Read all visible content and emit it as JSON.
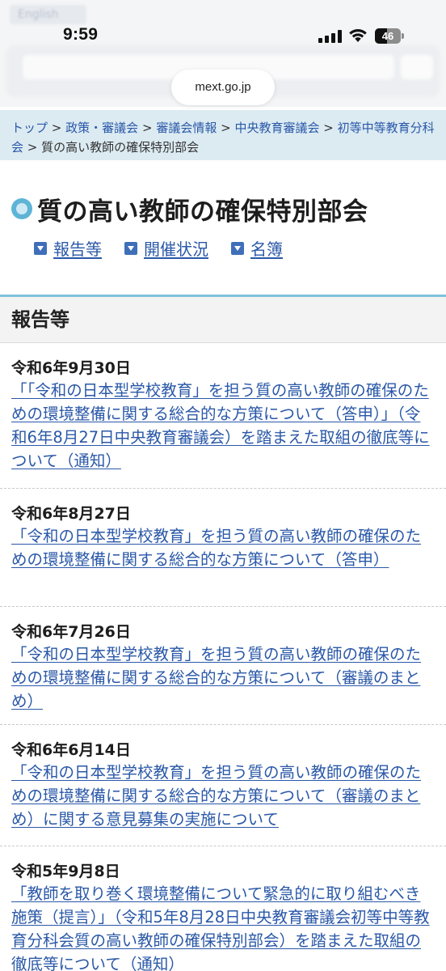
{
  "status_bar": {
    "time": "9:59",
    "battery_level": "46"
  },
  "browser": {
    "url": "mext.go.jp",
    "ghost_language_label": "English"
  },
  "breadcrumb": {
    "items": [
      "トップ",
      "政策・審議会",
      "審議会情報",
      "中央教育審議会",
      "初等中等教育分科会"
    ],
    "current": "質の高い教師の確保特別部会",
    "separator": ">"
  },
  "page": {
    "title": "質の高い教師の確保特別部会",
    "anchors": [
      "報告等",
      "開催状況",
      "名簿"
    ]
  },
  "section": {
    "heading": "報告等"
  },
  "entries": [
    {
      "date": "令和6年9月30日",
      "link": "「「令和の日本型学校教育」を担う質の高い教師の確保のための環境整備に関する総合的な方策について（答申）」（令和6年8月27日中央教育審議会）を踏まえた取組の徹底等について（通知）"
    },
    {
      "date": "令和6年8月27日",
      "link": "「令和の日本型学校教育」を担う質の高い教師の確保のための環境整備に関する総合的な方策について（答申）"
    },
    {
      "date": "令和6年7月26日",
      "link": "「令和の日本型学校教育」を担う質の高い教師の確保のための環境整備に関する総合的な方策について（審議のまとめ）"
    },
    {
      "date": "令和6年6月14日",
      "link": "「令和の日本型学校教育」を担う質の高い教師の確保のための環境整備に関する総合的な方策について（審議のまとめ）に関する意見募集の実施について"
    },
    {
      "date": "令和5年9月8日",
      "link": "「教師を取り巻く環境整備について緊急的に取り組むべき施策（提言）」（令和5年8月28日中央教育審議会初等中等教育分科会質の高い教師の確保特別部会）を踏まえた取組の徹底等について（通知）"
    }
  ],
  "colors": {
    "link": "#2a58a8",
    "breadcrumb_bg": "#dcebf2",
    "section_accent": "#7fc1da",
    "title_bullet": "#5eb4d6"
  }
}
